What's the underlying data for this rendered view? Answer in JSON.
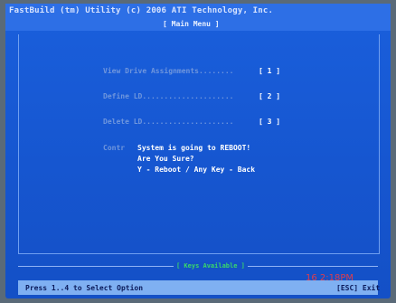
{
  "header": {
    "title": "FastBuild (tm) Utility (c) 2006 ATI Technology, Inc.",
    "menu": "[ Main Menu ]"
  },
  "menu": {
    "items": [
      {
        "label": "View Drive Assignments........",
        "key": "[ 1 ]"
      },
      {
        "label": "Define LD.....................",
        "key": "[ 2 ]"
      },
      {
        "label": "Delete LD.....................",
        "key": "[ 3 ]"
      }
    ]
  },
  "confirm": {
    "label": "Contr",
    "lines": [
      "System is going to REBOOT!",
      "Are You Sure?",
      "Y - Reboot / Any Key - Back"
    ]
  },
  "footer": {
    "keys_available": "[ Keys Available ]",
    "status": "Press 1..4 to Select Option",
    "esc": "[ESC] Exit"
  },
  "photo": {
    "timestamp": "16  2:18PM"
  },
  "colors": {
    "bios_blue": "#1656d0",
    "menu_text_dim": "#6f96dd",
    "highlight_white": "#ffffff",
    "status_bar": "#7fb0f2",
    "keys_green": "#38d86a",
    "timestamp_red": "#ff3a3a"
  }
}
